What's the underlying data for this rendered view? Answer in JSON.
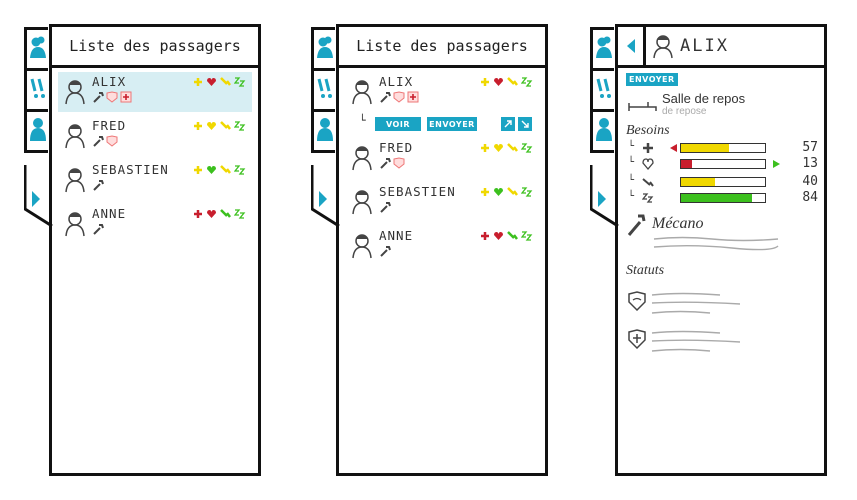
{
  "list": {
    "title": "Liste des passagers",
    "passengers": [
      {
        "name": "ALIX",
        "statuses": [
          "shield",
          "shield-cross"
        ],
        "needs": {
          "health": "yellow",
          "heart": "red",
          "energy": "yellow",
          "sleep": "green"
        }
      },
      {
        "name": "FRED",
        "statuses": [
          "shield"
        ],
        "needs": {
          "health": "yellow",
          "heart": "yellow",
          "energy": "yellow",
          "sleep": "green"
        }
      },
      {
        "name": "SEBASTIEN",
        "statuses": [],
        "needs": {
          "health": "yellow",
          "heart": "green",
          "energy": "yellow",
          "sleep": "green"
        }
      },
      {
        "name": "ANNE",
        "statuses": [],
        "needs": {
          "health": "red",
          "heart": "red",
          "energy": "green",
          "sleep": "green"
        }
      }
    ]
  },
  "actions": {
    "voir": "VOIR",
    "envoyer": "ENVOYER"
  },
  "detail": {
    "name": "ALIX",
    "badge": "ENVOYER",
    "location": "Salle de repos",
    "location_sub": "de repose",
    "needs_title": "Besoins",
    "needs": [
      {
        "icon": "health",
        "value": 57,
        "fraction": 0.57,
        "color": "#f0d800",
        "alert": "left-red"
      },
      {
        "icon": "heart",
        "value": 13,
        "fraction": 0.13,
        "color": "#c81e2d",
        "alert": "right-green"
      },
      {
        "icon": "energy",
        "value": 40,
        "fraction": 0.4,
        "color": "#f0d800",
        "alert": ""
      },
      {
        "icon": "sleep",
        "value": 84,
        "fraction": 0.84,
        "color": "#3cc01e",
        "alert": ""
      }
    ],
    "job": "Mécano",
    "statuts_title": "Statuts"
  },
  "colors": {
    "accent": "#1aa4c4",
    "yellow": "#f0d800",
    "red": "#c81e2d",
    "green": "#3cc01e",
    "sel": "#d7eef3"
  }
}
